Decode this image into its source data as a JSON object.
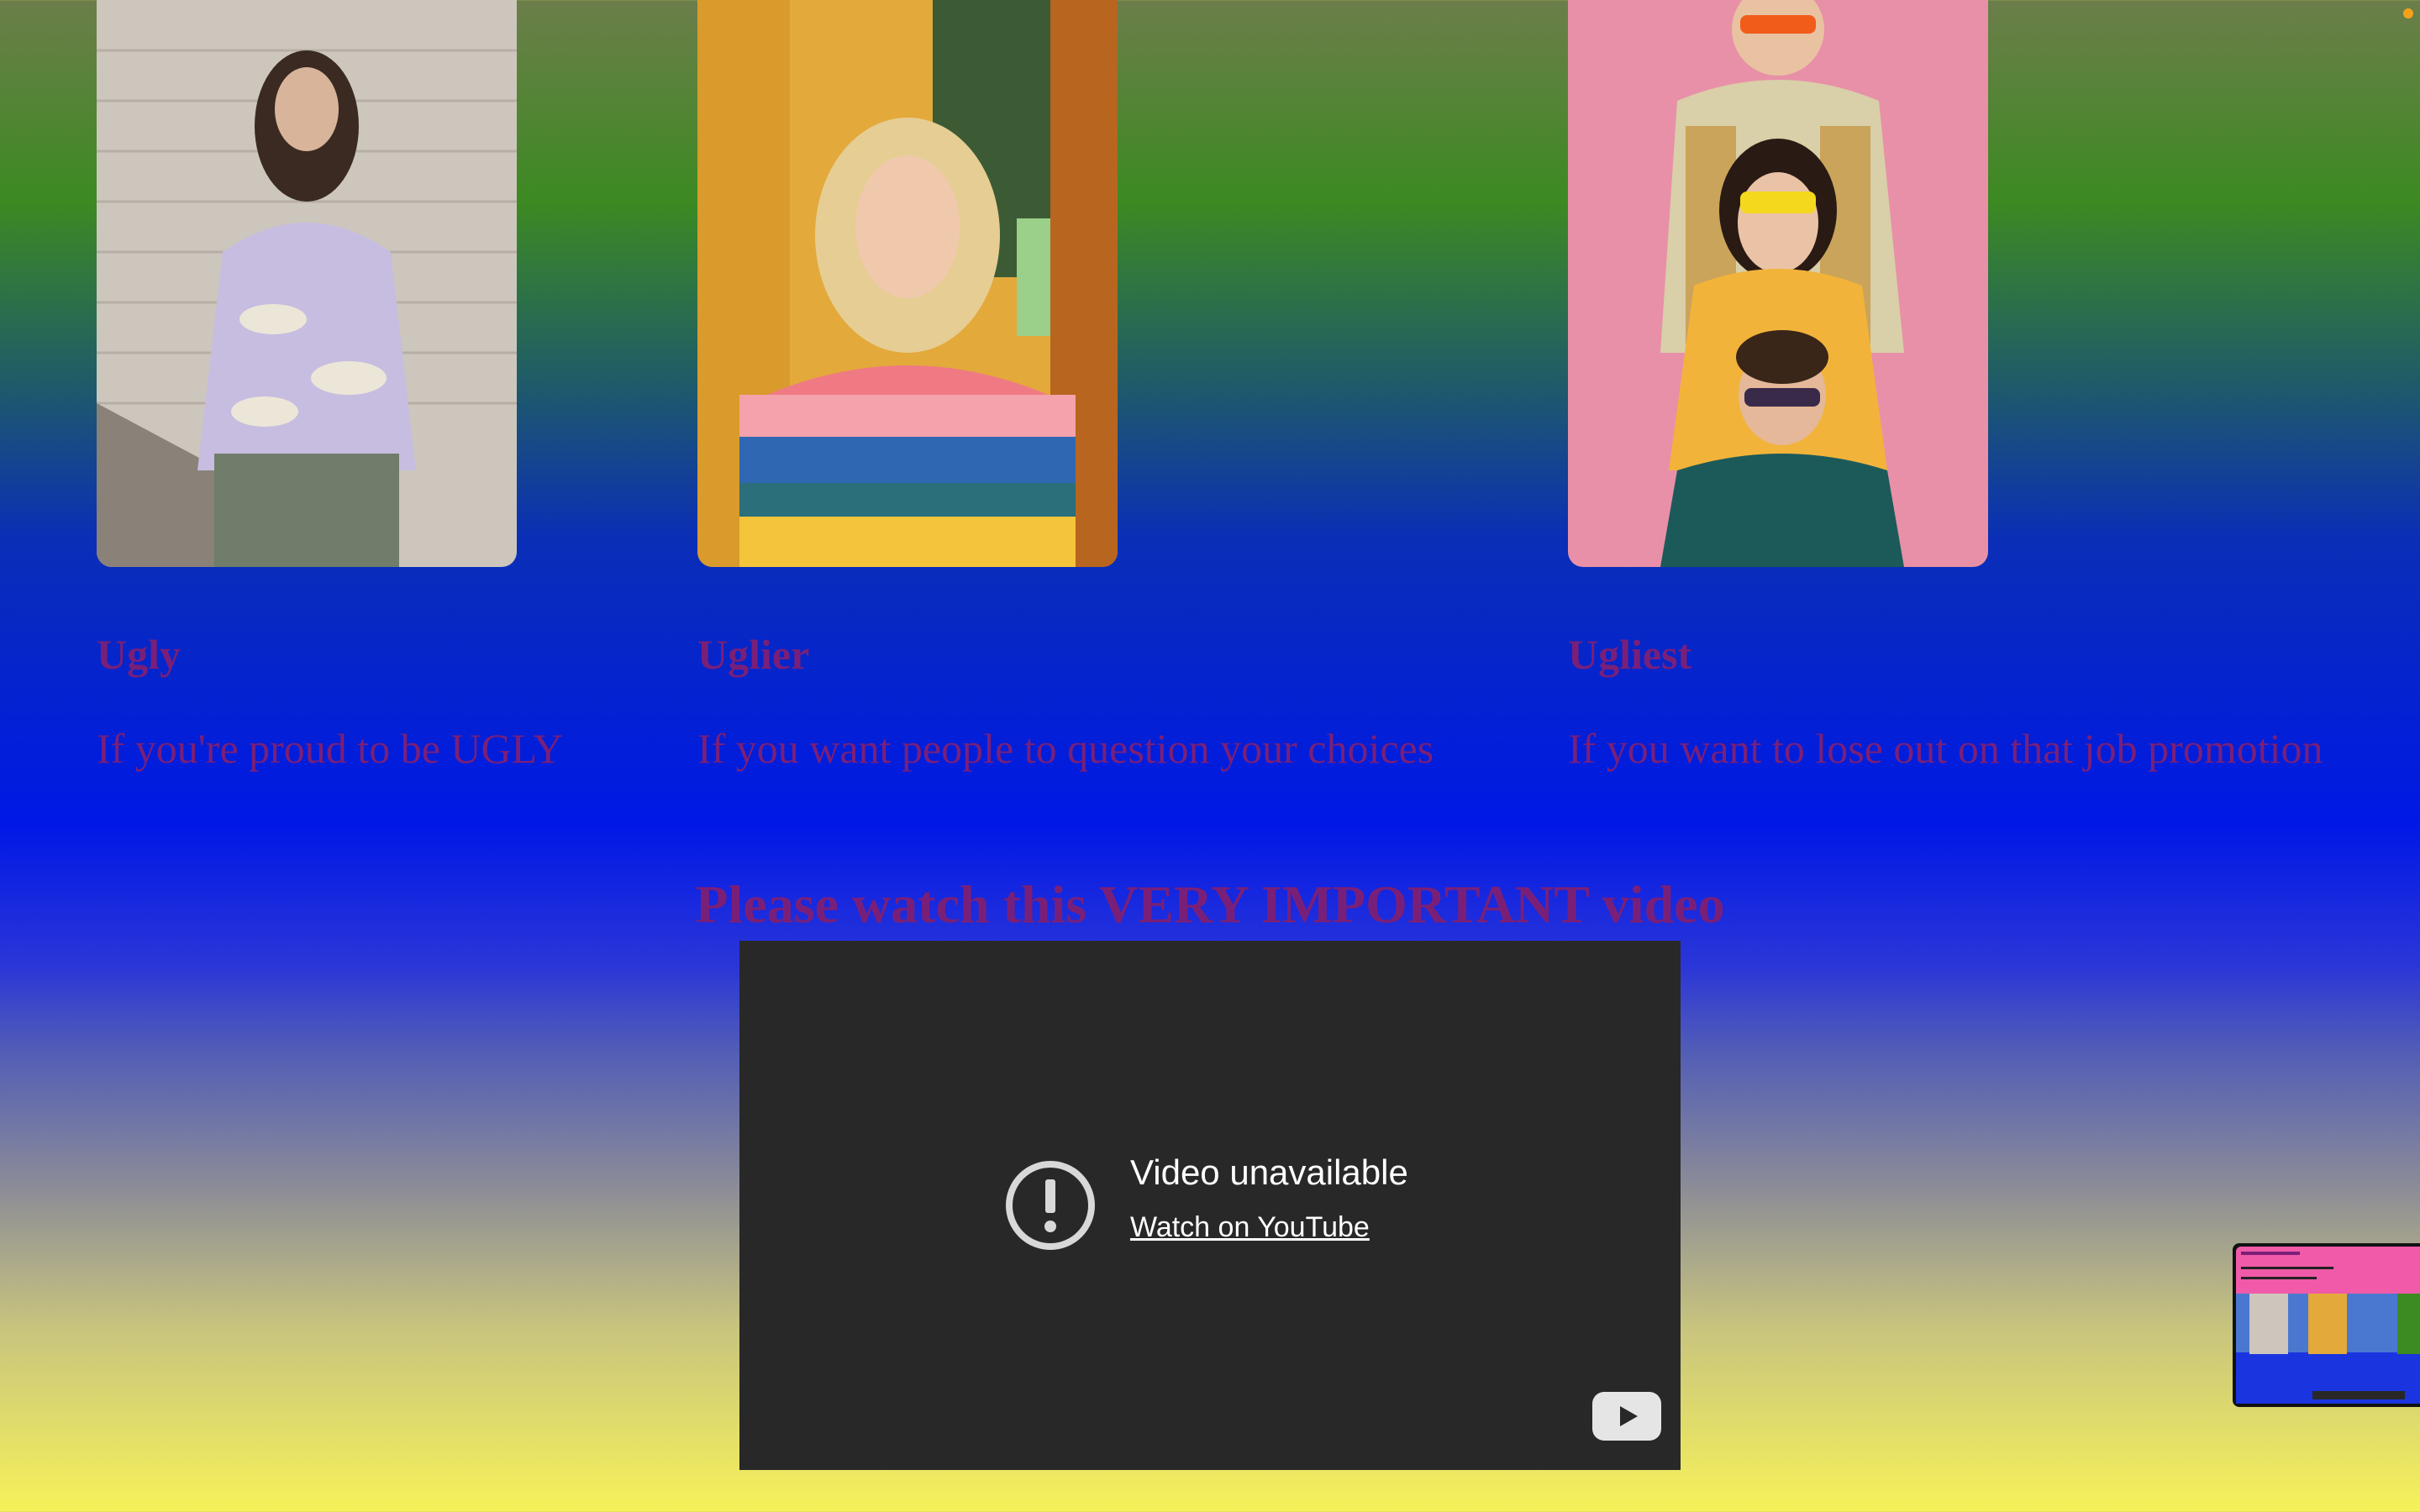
{
  "cards": [
    {
      "title": "Ugly",
      "description": "If you're proud to be UGLY",
      "image": "person-lavender-cloud-sweater-photo"
    },
    {
      "title": "Uglier",
      "description": "If you want people to question your choices",
      "image": "woman-rainbow-striped-sweater-photo"
    },
    {
      "title": "Ugliest",
      "description": "If you want to lose out on that job promotion",
      "image": "three-people-patterned-sweaters-photo"
    }
  ],
  "video_section": {
    "heading": "Please watch this VERY IMPORTANT video",
    "player": {
      "message": "Video unavailable",
      "link": "Watch on YouTube",
      "icon": "youtube-logo-icon"
    }
  },
  "colors": {
    "text_accent": "#7a1f78",
    "player_bg": "#282828"
  }
}
